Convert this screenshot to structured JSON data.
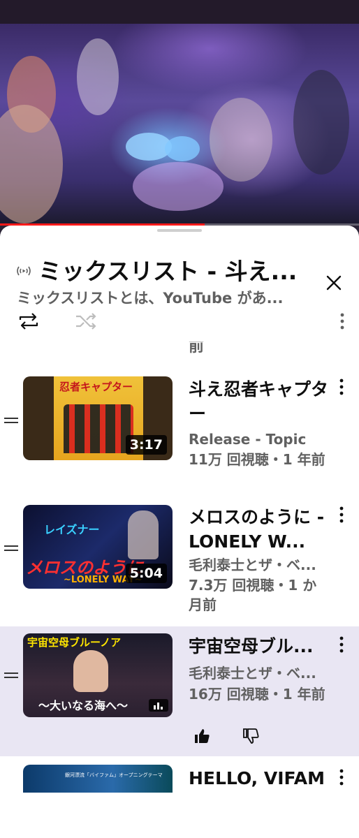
{
  "colors": {
    "accent": "#ff1a1a",
    "active_row": "#e9e6f3",
    "text_primary": "#0f0f0f",
    "text_secondary": "#606060"
  },
  "video": {
    "progress_fraction": 0.57
  },
  "playlist": {
    "title": "ミックスリスト - 斗え...",
    "subtitle": "ミックスリストとは、YouTube があ...",
    "icons": {
      "mix": "radio-broadcast-icon",
      "close": "close-icon",
      "repeat": "repeat-icon",
      "shuffle": "shuffle-icon",
      "more": "more-vert-icon"
    }
  },
  "partial_top_text": "前",
  "items": [
    {
      "title": "斗え忍者キャプター",
      "channel": "Release - Topic",
      "meta": "11万 回視聴・1 年前",
      "duration": "3:17",
      "thumb_text": "忍者キャプター",
      "active": false
    },
    {
      "title": "メロスのように -LONELY W...",
      "channel": "毛利泰士とザ・ベ...",
      "meta": "7.3万 回視聴・1 か月前",
      "duration": "5:04",
      "thumb_text": "メロスのように",
      "thumb_text_2": "~LONELY WAY~",
      "thumb_text_3": "レイズナー",
      "active": false
    },
    {
      "title": "宇宙空母ブル...",
      "channel": "毛利泰士とザ・ベ...",
      "meta": "16万 回視聴・1 年前",
      "thumb_text": "宇宙空母ブルーノア",
      "thumb_text_2": "〜大いなる海へ〜",
      "active": true
    },
    {
      "title": "HELLO, VIFAM",
      "thumb_text": "銀河漂流「バイファム」オープニングテーマ"
    }
  ]
}
